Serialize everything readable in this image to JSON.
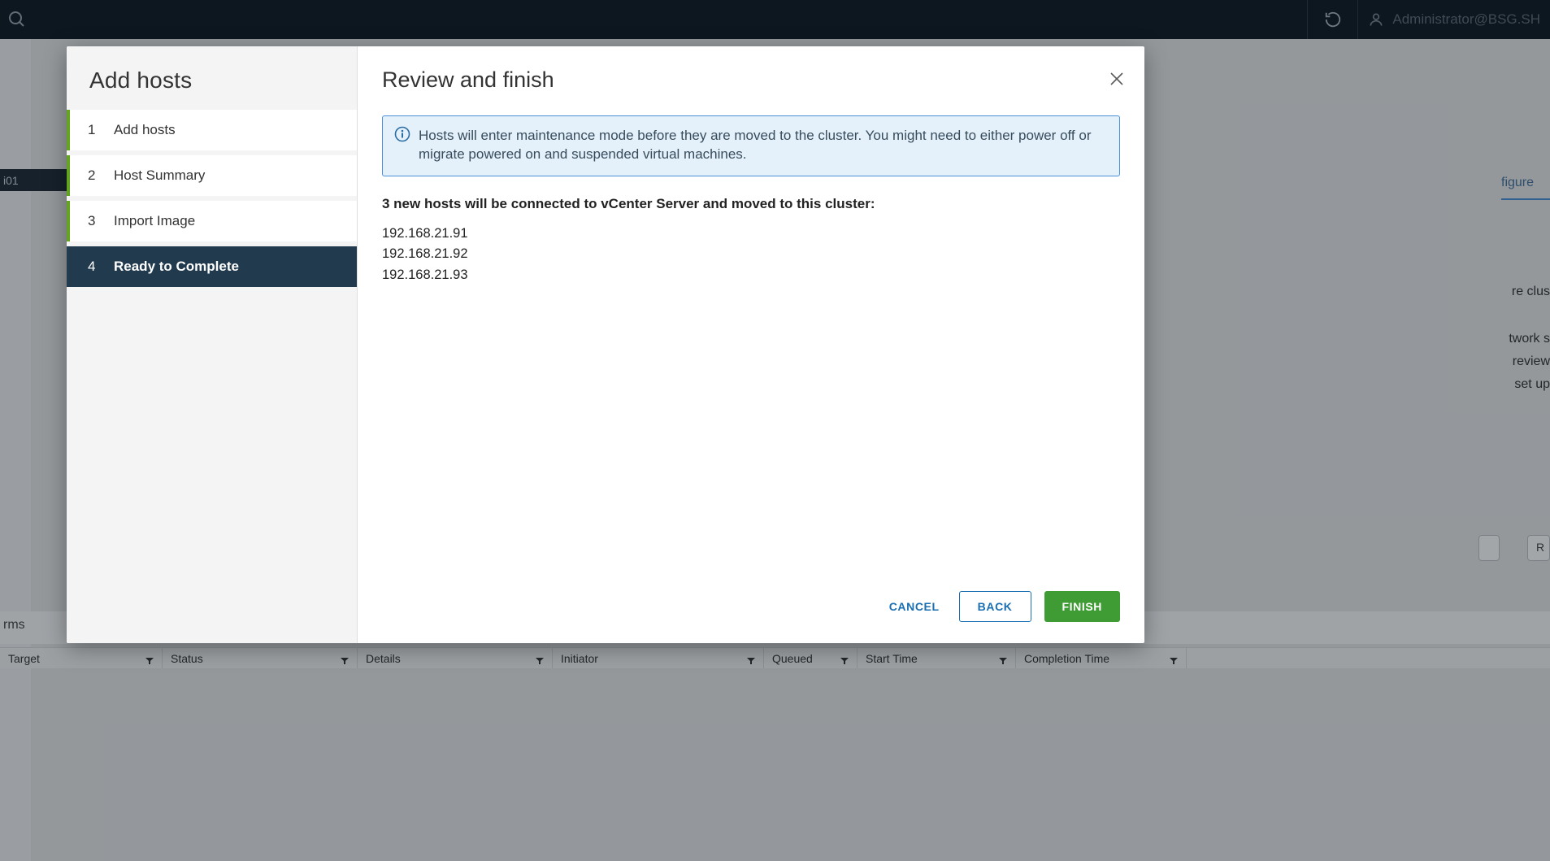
{
  "topbar": {
    "user_label": "Administrator@BSG.SH"
  },
  "background": {
    "selected_nav_item": "i01",
    "right_tab": "figure",
    "right_text_1": "re clus",
    "right_text_2": "twork s",
    "right_text_3": "review",
    "right_text_4": "set up",
    "recent_bar_text": "rms",
    "btn_r_label": "R",
    "table_columns": [
      "Target",
      "Status",
      "Details",
      "Initiator",
      "Queued",
      "Start Time",
      "Completion Time"
    ]
  },
  "wizard": {
    "title": "Add hosts",
    "steps": [
      {
        "num": "1",
        "label": "Add hosts"
      },
      {
        "num": "2",
        "label": "Host Summary"
      },
      {
        "num": "3",
        "label": "Import Image"
      },
      {
        "num": "4",
        "label": "Ready to Complete"
      }
    ],
    "content": {
      "heading": "Review and finish",
      "info_text": "Hosts will enter maintenance mode before they are moved to the cluster. You might need to either power off or migrate powered on and suspended virtual machines.",
      "summary_heading": "3 new hosts will be connected to vCenter Server and moved to this cluster:",
      "hosts": [
        "192.168.21.91",
        "192.168.21.92",
        "192.168.21.93"
      ]
    },
    "buttons": {
      "cancel": "CANCEL",
      "back": "BACK",
      "finish": "FINISH"
    }
  }
}
